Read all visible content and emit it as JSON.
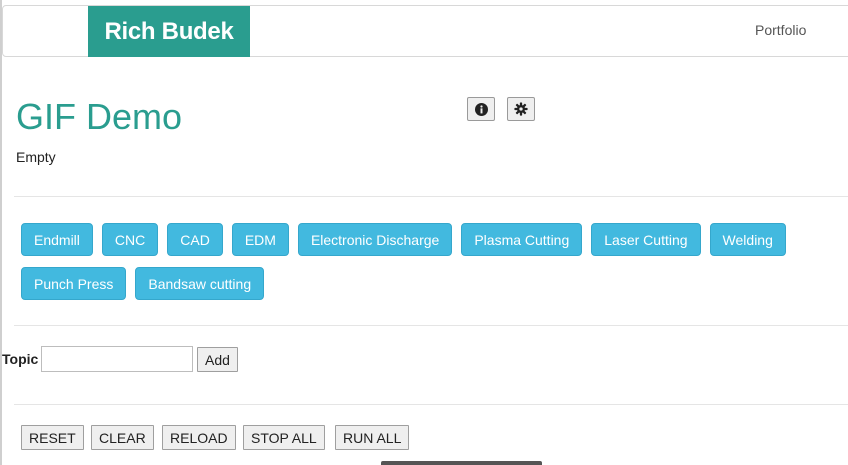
{
  "header": {
    "brand": "Rich Budek",
    "nav_link": "Portfolio"
  },
  "main": {
    "title": "GIF Demo",
    "status": "Empty",
    "icons": [
      "info-icon",
      "gear-icon"
    ]
  },
  "tags": {
    "row1": [
      "Endmill",
      "CNC",
      "CAD",
      "EDM",
      "Electronic Discharge",
      "Plasma Cutting",
      "Laser Cutting",
      "Welding"
    ],
    "row2": [
      "Punch Press",
      "Bandsaw cutting"
    ]
  },
  "topic_form": {
    "label": "Topic",
    "input_value": "",
    "add_label": "Add"
  },
  "controls": {
    "reset": "RESET",
    "clear": "CLEAR",
    "reload": "RELOAD",
    "stop_all": "STOP ALL",
    "run_all": "RUN ALL"
  },
  "colors": {
    "brand": "#2a9d8f",
    "tag": "#42b9df"
  }
}
